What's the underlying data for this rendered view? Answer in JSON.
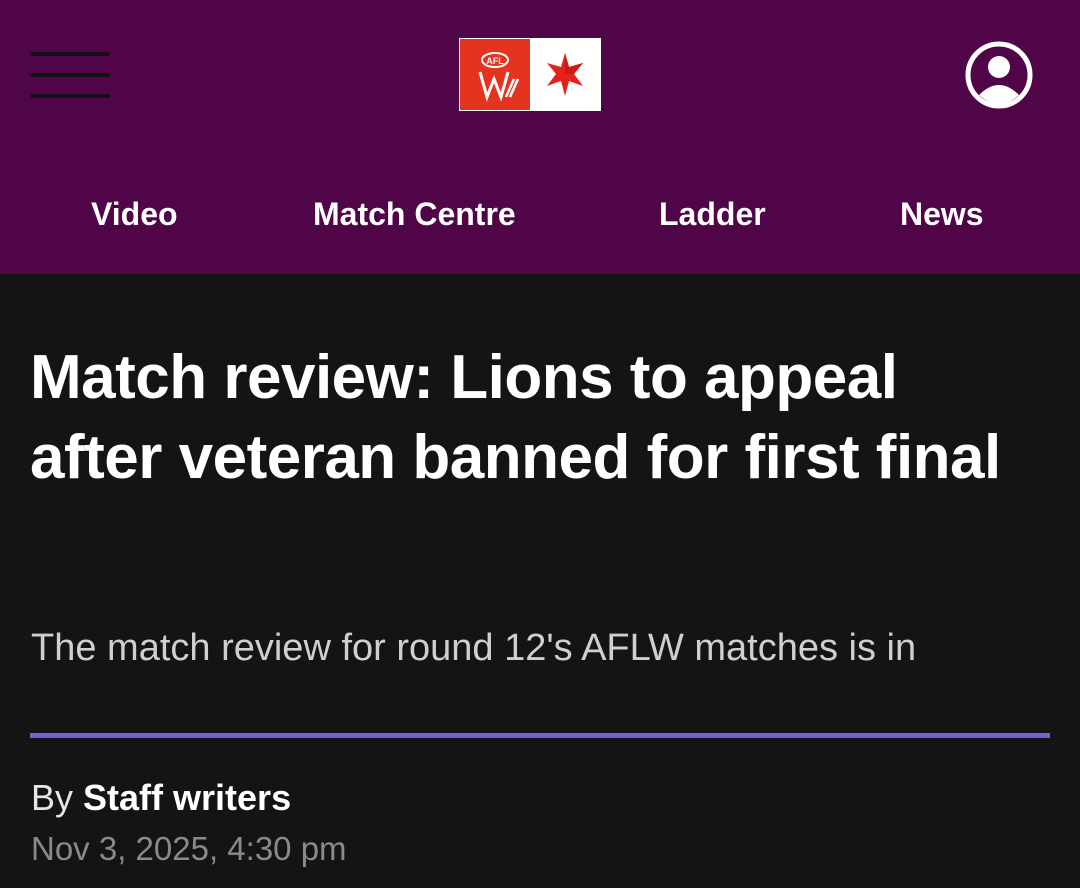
{
  "header": {
    "menu_icon": "hamburger-menu-icon",
    "logo": {
      "left_text": "AFL",
      "left_mark": "W",
      "left_color": "#e4331f",
      "right_icon": "nab-star-icon",
      "right_color": "#ffffff"
    },
    "account_icon": "user-account-icon",
    "background": "#4f0547"
  },
  "nav": {
    "items": [
      {
        "label": "Video"
      },
      {
        "label": "Match Centre"
      },
      {
        "label": "Ladder"
      },
      {
        "label": "News"
      }
    ]
  },
  "article": {
    "headline": "Match review: Lions to appeal after veteran banned for first final",
    "standfirst": "The match review for round 12's AFLW matches is in",
    "byline_prefix": "By",
    "author": "Staff writers",
    "timestamp": "Nov 3, 2025, 4:30 pm",
    "accent_color": "#6b66cf"
  }
}
